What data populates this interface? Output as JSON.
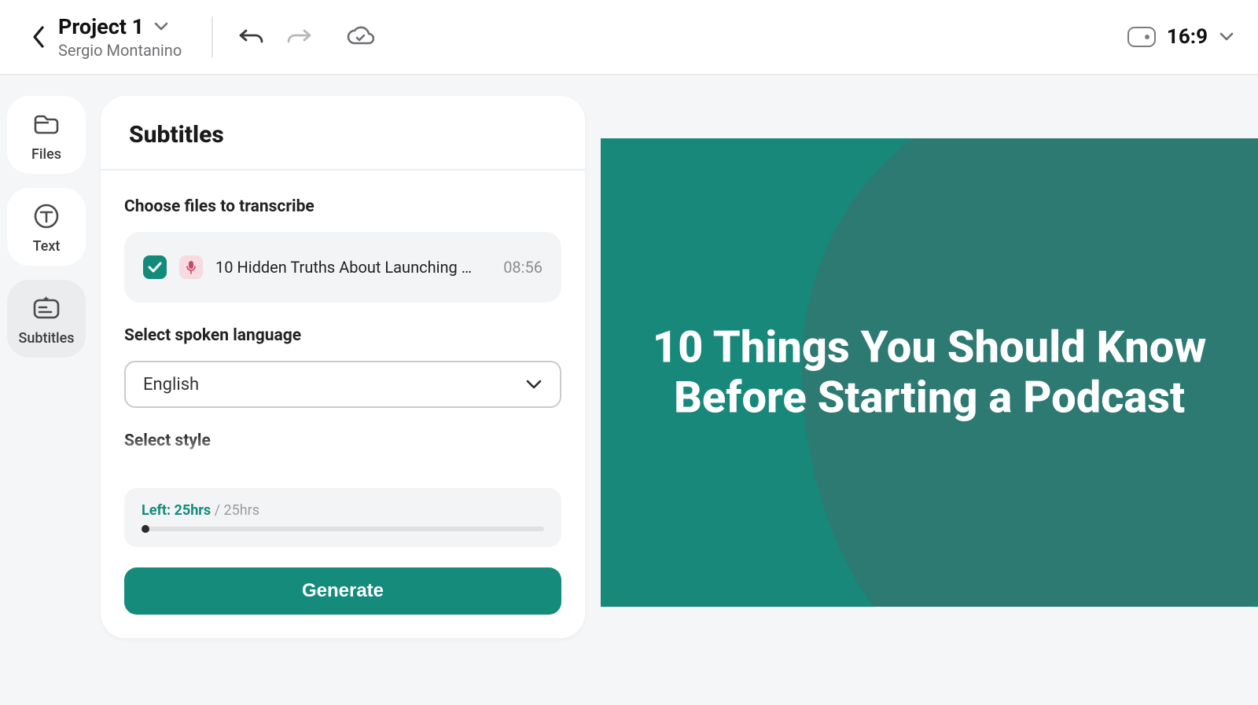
{
  "header": {
    "project_name": "Project 1",
    "owner": "Sergio Montanino",
    "aspect_ratio": "16:9"
  },
  "rail": {
    "items": [
      {
        "label": "Files"
      },
      {
        "label": "Text"
      },
      {
        "label": "Subtitles"
      }
    ]
  },
  "panel": {
    "title": "Subtitles",
    "choose_files_label": "Choose files to transcribe",
    "file": {
      "name": "10 Hidden Truths About Launching …",
      "duration": "08:56"
    },
    "language_label": "Select spoken language",
    "language_value": "English",
    "style_label": "Select style",
    "quota": {
      "left": "Left: 25hrs",
      "total": "/ 25hrs"
    },
    "generate_label": "Generate"
  },
  "preview": {
    "title": "10 Things You Should Know Before Starting a Podcast"
  }
}
